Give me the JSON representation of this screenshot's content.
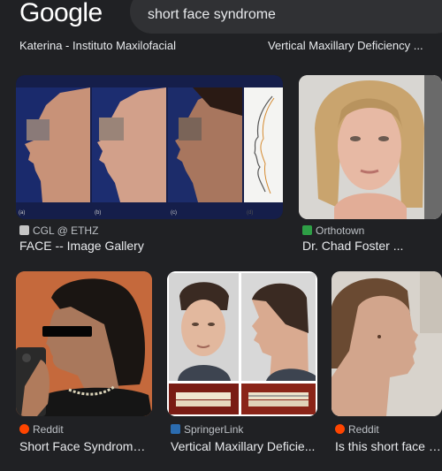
{
  "header": {
    "logo": "Google",
    "query": "short face syndrome"
  },
  "top_captions": [
    "Katerina - Instituto Maxilofacial",
    "Vertical Maxillary Deficiency ..."
  ],
  "results": [
    {
      "source": "CGL @ ETHZ",
      "title": "FACE -- Image Gallery",
      "fav_color": "#c5c5c5"
    },
    {
      "source": "Orthotown",
      "title": "Dr. Chad Foster ...",
      "fav_color": "#2e9f46"
    },
    {
      "source": "Reddit",
      "title": "Short Face Syndrome ...",
      "fav_color": "#ff4500"
    },
    {
      "source": "SpringerLink",
      "title": "Vertical Maxillary Deficie...",
      "fav_color": "#2b6cb0"
    },
    {
      "source": "Reddit",
      "title": "Is this short face s...",
      "fav_color": "#ff4500"
    }
  ],
  "panel_labels": [
    "(a)",
    "(b)",
    "(c)",
    "(d)"
  ]
}
